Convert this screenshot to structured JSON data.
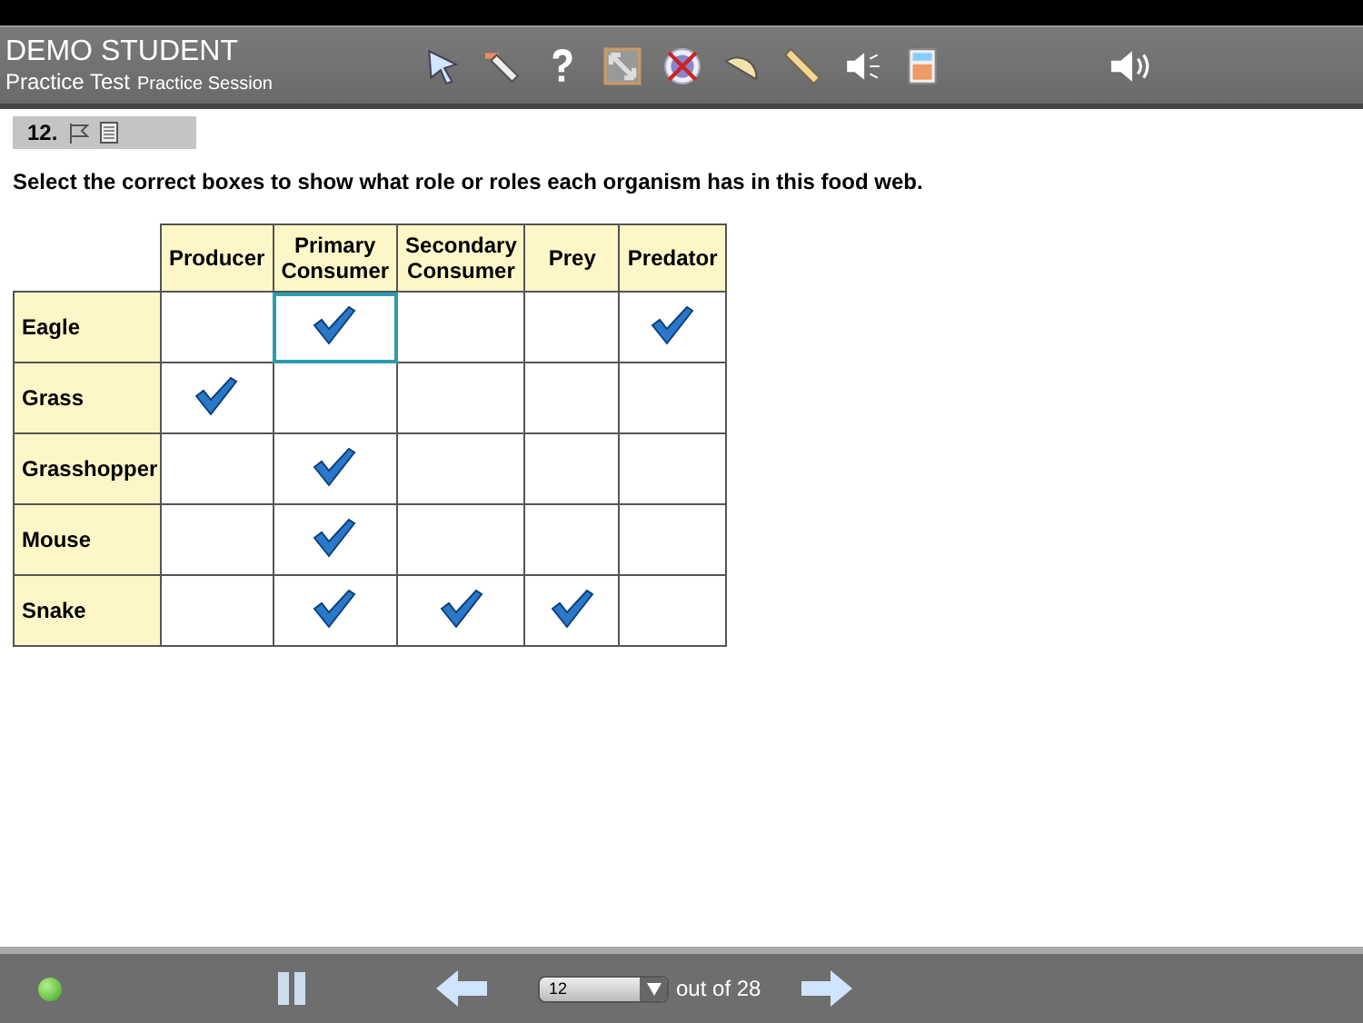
{
  "header": {
    "student": "DEMO STUDENT",
    "test": "Practice Test",
    "session": "Practice Session"
  },
  "question": {
    "number": "12."
  },
  "instruction": "Select the correct boxes to show what role or roles each organism has in this food web.",
  "table": {
    "columns": [
      "Producer",
      "Primary Consumer",
      "Secondary Consumer",
      "Prey",
      "Predator"
    ],
    "rows": [
      {
        "organism": "Eagle",
        "cells": [
          {
            "checked": false,
            "focused": false
          },
          {
            "checked": true,
            "focused": true
          },
          {
            "checked": false,
            "focused": false
          },
          {
            "checked": false,
            "focused": false
          },
          {
            "checked": true,
            "focused": false
          }
        ]
      },
      {
        "organism": "Grass",
        "cells": [
          {
            "checked": true,
            "focused": false
          },
          {
            "checked": false,
            "focused": false
          },
          {
            "checked": false,
            "focused": false
          },
          {
            "checked": false,
            "focused": false
          },
          {
            "checked": false,
            "focused": false
          }
        ]
      },
      {
        "organism": "Grasshopper",
        "cells": [
          {
            "checked": false,
            "focused": false
          },
          {
            "checked": true,
            "focused": false
          },
          {
            "checked": false,
            "focused": false
          },
          {
            "checked": false,
            "focused": false
          },
          {
            "checked": false,
            "focused": false
          }
        ]
      },
      {
        "organism": "Mouse",
        "cells": [
          {
            "checked": false,
            "focused": false
          },
          {
            "checked": true,
            "focused": false
          },
          {
            "checked": false,
            "focused": false
          },
          {
            "checked": false,
            "focused": false
          },
          {
            "checked": false,
            "focused": false
          }
        ]
      },
      {
        "organism": "Snake",
        "cells": [
          {
            "checked": false,
            "focused": false
          },
          {
            "checked": true,
            "focused": false
          },
          {
            "checked": true,
            "focused": false
          },
          {
            "checked": true,
            "focused": false
          },
          {
            "checked": false,
            "focused": false
          }
        ]
      }
    ]
  },
  "footer": {
    "page": "12",
    "total": "out of 28"
  }
}
